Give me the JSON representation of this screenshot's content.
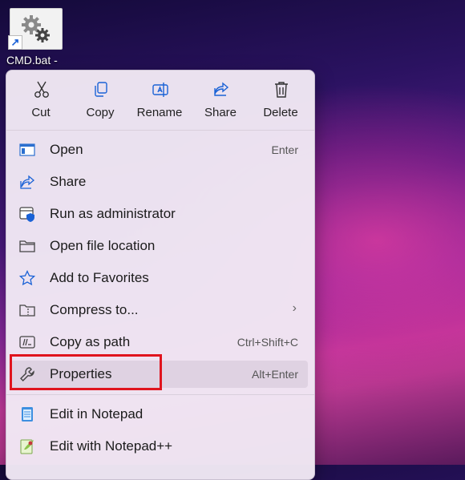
{
  "desktop": {
    "icon_label": "CMD.bat -"
  },
  "toolbar": [
    {
      "label": "Cut",
      "icon": "scissors-icon"
    },
    {
      "label": "Copy",
      "icon": "copy-icon"
    },
    {
      "label": "Rename",
      "icon": "rename-icon"
    },
    {
      "label": "Share",
      "icon": "share-icon"
    },
    {
      "label": "Delete",
      "icon": "trash-icon"
    }
  ],
  "menu": {
    "items": [
      {
        "label": "Open",
        "accel": "Enter",
        "icon": "window-icon"
      },
      {
        "label": "Share",
        "accel": "",
        "icon": "share-icon"
      },
      {
        "label": "Run as administrator",
        "accel": "",
        "icon": "shield-window-icon"
      },
      {
        "label": "Open file location",
        "accel": "",
        "icon": "folder-icon"
      },
      {
        "label": "Add to Favorites",
        "accel": "",
        "icon": "star-icon"
      },
      {
        "label": "Compress to...",
        "accel": "",
        "icon": "zip-folder-icon",
        "submenu": true
      },
      {
        "label": "Copy as path",
        "accel": "Ctrl+Shift+C",
        "icon": "path-icon"
      },
      {
        "label": "Properties",
        "accel": "Alt+Enter",
        "icon": "wrench-icon",
        "highlighted": true
      },
      {
        "label": "Edit in Notepad",
        "accel": "",
        "icon": "notepad-icon"
      },
      {
        "label": "Edit with Notepad++",
        "accel": "",
        "icon": "notepadpp-icon"
      }
    ],
    "submenu_arrow": "›"
  },
  "colors": {
    "highlight_box": "#e0141e",
    "accent": "#1a62d6"
  }
}
